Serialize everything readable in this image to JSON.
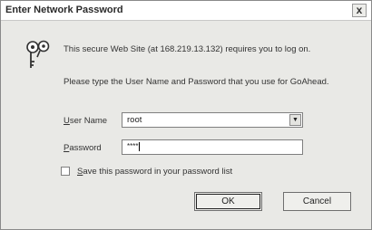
{
  "dialog": {
    "title": "Enter Network Password",
    "close_label": "x",
    "message": "This secure Web Site (at 168.219.13.132) requires you to log on.",
    "instruction": "Please type the User Name and Password that you use for GoAhead.",
    "user_name": {
      "label_access": "U",
      "label_rest": "ser Name",
      "value": "root"
    },
    "password": {
      "label_access": "P",
      "label_rest": "assword",
      "value": "****"
    },
    "save_password": {
      "label_access": "S",
      "label_rest": "ave this password in your password list",
      "checked": false
    },
    "ok_label": "OK",
    "cancel_label": "Cancel"
  }
}
